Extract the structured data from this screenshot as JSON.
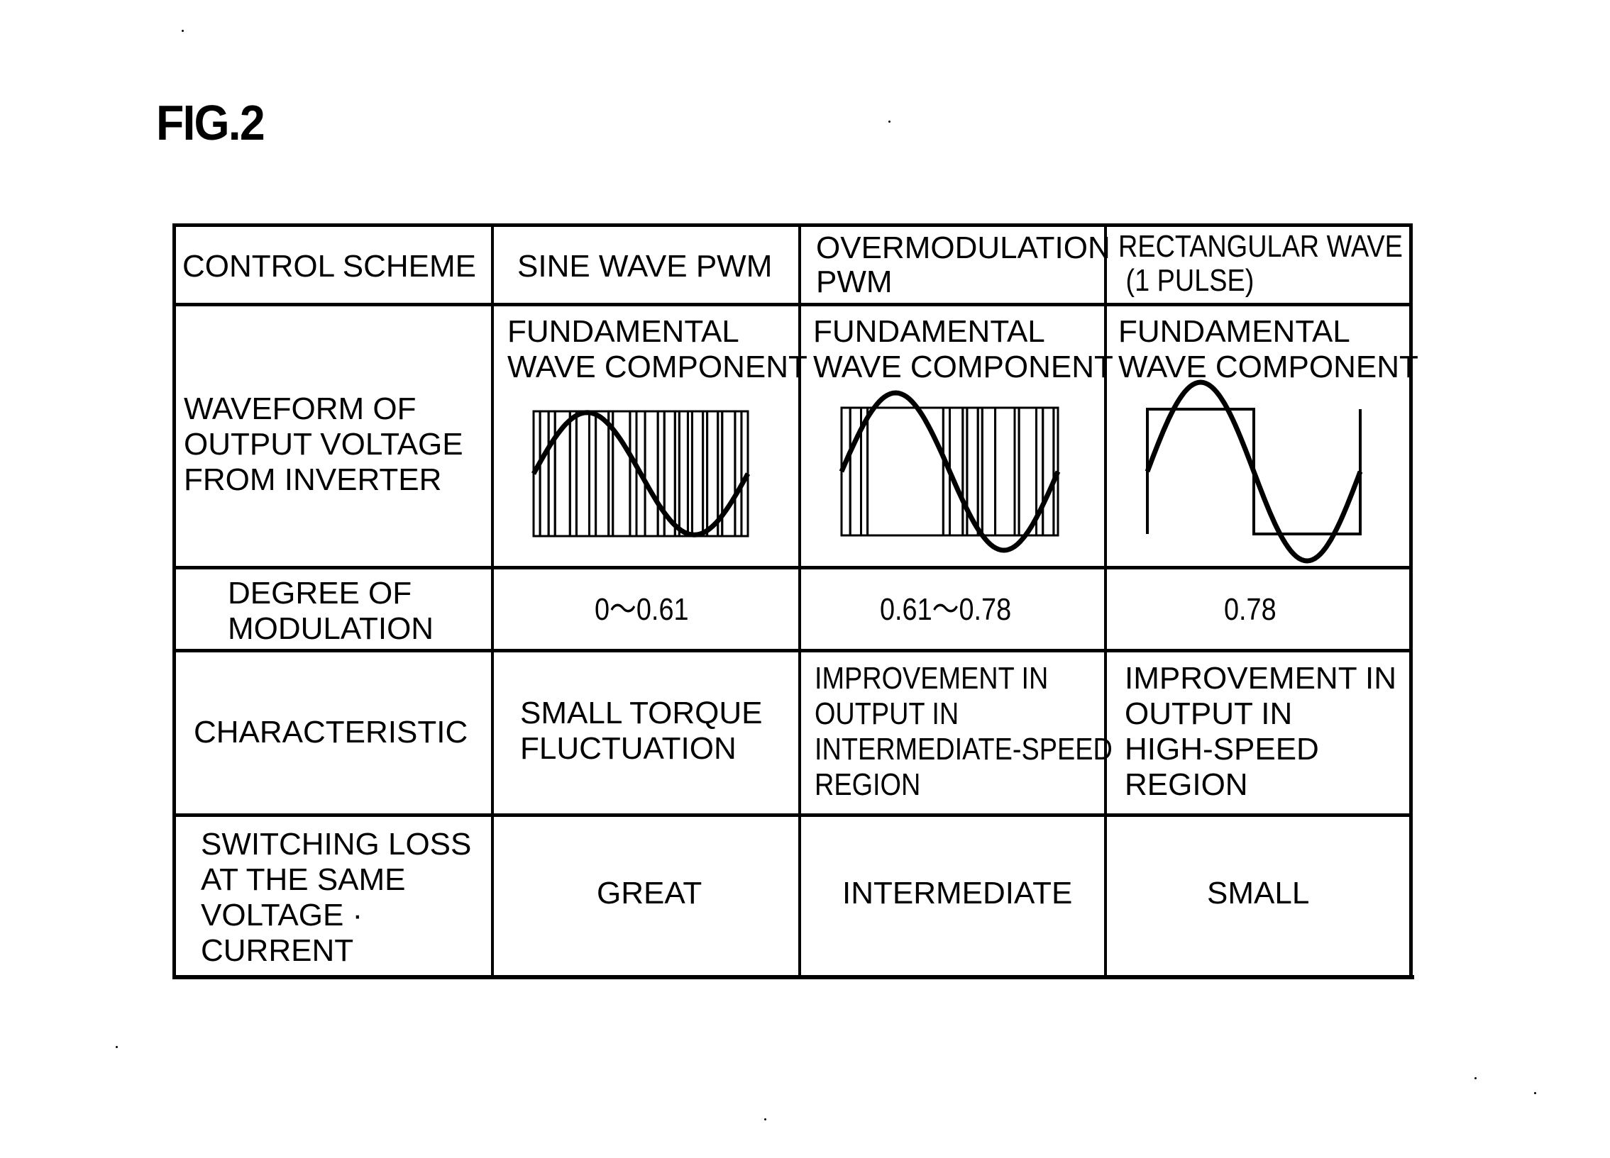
{
  "figure": {
    "label": "FIG.2"
  },
  "table": {
    "row_headers": {
      "control_scheme": "CONTROL SCHEME",
      "waveform": [
        "WAVEFORM OF",
        "OUTPUT VOLTAGE",
        "FROM INVERTER"
      ],
      "degree": [
        "DEGREE OF",
        "MODULATION"
      ],
      "characteristic": "CHARACTERISTIC",
      "switching_loss": [
        "SWITCHING LOSS",
        "AT THE SAME",
        "VOLTAGE ·",
        "CURRENT"
      ]
    },
    "columns": [
      {
        "scheme": [
          "SINE WAVE PWM"
        ],
        "waveform_caption": [
          "FUNDAMENTAL",
          "WAVE COMPONENT"
        ],
        "waveform_type": "sine-pwm",
        "degree_of_modulation": "0～0.61",
        "characteristic": [
          "SMALL TORQUE",
          "FLUCTUATION"
        ],
        "switching_loss": "GREAT"
      },
      {
        "scheme": [
          "OVERMODULATION",
          "PWM"
        ],
        "waveform_caption": [
          "FUNDAMENTAL",
          "WAVE COMPONENT"
        ],
        "waveform_type": "overmodulation-pwm",
        "degree_of_modulation": "0.61～0.78",
        "characteristic": [
          "IMPROVEMENT IN",
          "OUTPUT IN",
          "INTERMEDIATE-SPEED",
          "REGION"
        ],
        "switching_loss": "INTERMEDIATE"
      },
      {
        "scheme": [
          "RECTANGULAR WAVE",
          " (1 PULSE)"
        ],
        "waveform_caption": [
          "FUNDAMENTAL",
          "WAVE COMPONENT"
        ],
        "waveform_type": "rectangular-1-pulse",
        "degree_of_modulation": "0.78",
        "characteristic": [
          "IMPROVEMENT IN",
          "OUTPUT IN",
          "HIGH-SPEED",
          "REGION"
        ],
        "switching_loss": "SMALL"
      }
    ]
  },
  "waveforms": {
    "sine_pwm": {
      "fundamental_amplitude_ratio": 0.61,
      "pulse_edges": [
        0.0,
        0.03,
        0.07,
        0.1,
        0.17,
        0.2,
        0.26,
        0.29,
        0.35,
        0.37,
        0.45,
        0.48,
        0.52,
        0.58,
        0.61,
        0.66,
        0.68,
        0.72,
        0.74,
        0.79,
        0.81,
        0.86,
        0.88,
        0.94,
        0.97,
        1.0
      ]
    },
    "overmodulation_pwm": {
      "fundamental_amplitude_ratio": 0.78,
      "pulse_edges": [
        0.0,
        0.04,
        0.09,
        0.12,
        0.47,
        0.5,
        0.56,
        0.58,
        0.63,
        0.65,
        0.71,
        0.8,
        0.82,
        0.9,
        0.93,
        0.98,
        1.0
      ]
    },
    "rectangular": {
      "fundamental_amplitude_ratio": 0.78
    }
  }
}
